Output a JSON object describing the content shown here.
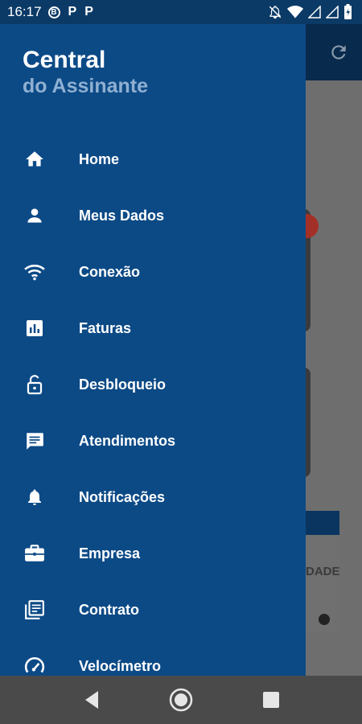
{
  "status_bar": {
    "time": "16:17",
    "icons": [
      "b-circle-icon",
      "p-icon",
      "p-icon",
      "mute-icon",
      "wifi-icon",
      "signal-icon",
      "signal-icon",
      "battery-icon"
    ],
    "b_label": "B",
    "p_label": "P"
  },
  "drawer": {
    "title_line1": "Central",
    "title_line2": "do Assinante",
    "items": [
      {
        "label": "Home",
        "icon": "home-icon"
      },
      {
        "label": "Meus Dados",
        "icon": "person-icon"
      },
      {
        "label": "Conexão",
        "icon": "wifi-icon"
      },
      {
        "label": "Faturas",
        "icon": "bar-chart-icon"
      },
      {
        "label": "Desbloqueio",
        "icon": "unlock-icon"
      },
      {
        "label": "Atendimentos",
        "icon": "chat-icon"
      },
      {
        "label": "Notificações",
        "icon": "bell-icon"
      },
      {
        "label": "Empresa",
        "icon": "briefcase-icon"
      },
      {
        "label": "Contrato",
        "icon": "document-icon"
      },
      {
        "label": "Velocímetro",
        "icon": "speedometer-icon"
      }
    ]
  },
  "background": {
    "map_text": "DADE"
  },
  "colors": {
    "drawer_bg": "#0c4a86",
    "status_bg": "#0c3a66",
    "subtitle": "#8fb0d2",
    "scrim": "#6e6e6e"
  }
}
